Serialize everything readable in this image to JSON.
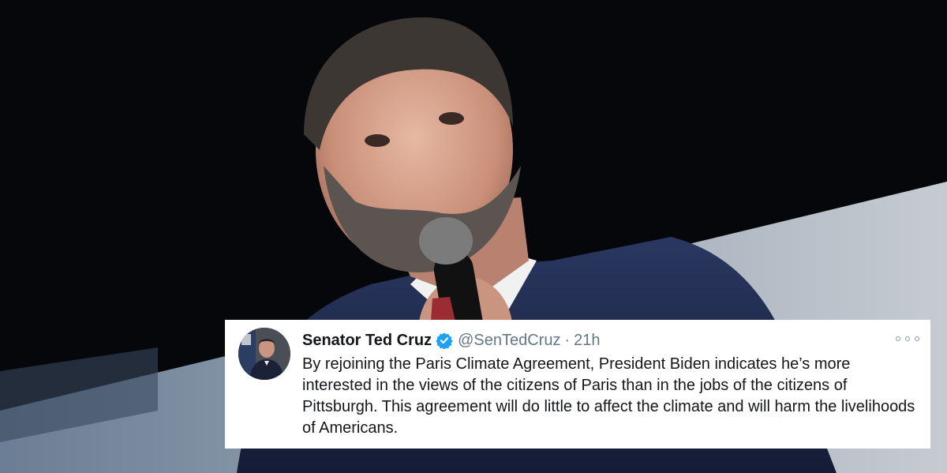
{
  "tweet": {
    "display_name": "Senator Ted Cruz",
    "handle": "@SenTedCruz",
    "separator": "·",
    "timestamp": "21h",
    "text": "By rejoining the Paris Climate Agreement, President Biden indicates he’s more interested in the views of the citizens of Paris than in the jobs of the citizens of Pittsburgh. This agreement will do little to affect the climate and will harm the livelihoods of Americans.",
    "verified": true
  },
  "icons": {
    "verified": "verified-badge-icon",
    "more": "more-options-icon",
    "avatar": "profile-avatar"
  },
  "colors": {
    "card_background": "#ffffff",
    "name_text": "#14171a",
    "secondary_text": "#657786",
    "verified_blue": "#1da1f2",
    "photo_background": "#05070b",
    "suit_navy": "#1f2a4a"
  }
}
